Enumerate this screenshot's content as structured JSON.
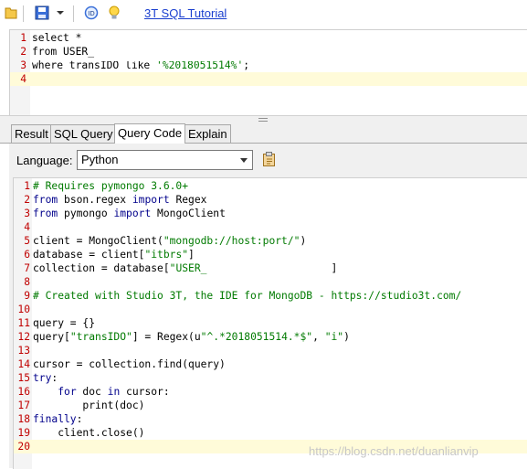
{
  "toolbar": {
    "link_label": "3T SQL Tutorial",
    "icons": [
      "open-folder-icon",
      "save-icon",
      "dropdown-arrow-icon",
      "connect-icon",
      "lightbulb-icon"
    ]
  },
  "sql_editor": {
    "lines": [
      {
        "n": "1",
        "parts": [
          {
            "t": "select *",
            "c": "plain"
          }
        ]
      },
      {
        "n": "2",
        "parts": [
          {
            "t": "from USER_",
            "c": "plain"
          }
        ]
      },
      {
        "n": "3",
        "parts": [
          {
            "t": "where transIDO like ",
            "c": "plain"
          },
          {
            "t": "'%2018051514%'",
            "c": "str"
          },
          {
            "t": ";",
            "c": "plain"
          }
        ]
      },
      {
        "n": "4",
        "parts": []
      }
    ]
  },
  "tabs": [
    {
      "label": "Result",
      "active": false
    },
    {
      "label": "SQL Query",
      "active": false
    },
    {
      "label": "Query Code",
      "active": true
    },
    {
      "label": "Explain",
      "active": false
    }
  ],
  "language": {
    "label": "Language:",
    "selected": "Python"
  },
  "python_code": {
    "lines": [
      {
        "n": "1",
        "parts": [
          {
            "t": "# Requires pymongo 3.6.0+",
            "c": "cmt"
          }
        ]
      },
      {
        "n": "2",
        "parts": [
          {
            "t": "from",
            "c": "kw"
          },
          {
            "t": " bson.regex ",
            "c": "plain"
          },
          {
            "t": "import",
            "c": "kw"
          },
          {
            "t": " Regex",
            "c": "plain"
          }
        ]
      },
      {
        "n": "3",
        "parts": [
          {
            "t": "from",
            "c": "kw"
          },
          {
            "t": " pymongo ",
            "c": "plain"
          },
          {
            "t": "import",
            "c": "kw"
          },
          {
            "t": " MongoClient",
            "c": "plain"
          }
        ]
      },
      {
        "n": "4",
        "parts": []
      },
      {
        "n": "5",
        "parts": [
          {
            "t": "client = MongoClient(",
            "c": "plain"
          },
          {
            "t": "\"mongodb://host:port/\"",
            "c": "str"
          },
          {
            "t": ")",
            "c": "plain"
          }
        ]
      },
      {
        "n": "6",
        "parts": [
          {
            "t": "database = client[",
            "c": "plain"
          },
          {
            "t": "\"itbrs\"",
            "c": "str"
          },
          {
            "t": "]",
            "c": "plain"
          }
        ]
      },
      {
        "n": "7",
        "parts": [
          {
            "t": "collection = database[",
            "c": "plain"
          },
          {
            "t": "\"USER_",
            "c": "str"
          },
          {
            "t": "                    ",
            "c": "plain"
          },
          {
            "t": "]",
            "c": "plain"
          }
        ]
      },
      {
        "n": "8",
        "parts": []
      },
      {
        "n": "9",
        "parts": [
          {
            "t": "# Created with Studio 3T, the IDE for MongoDB - https://studio3t.com/",
            "c": "cmt"
          }
        ]
      },
      {
        "n": "10",
        "parts": []
      },
      {
        "n": "11",
        "parts": [
          {
            "t": "query = {}",
            "c": "plain"
          }
        ]
      },
      {
        "n": "12",
        "parts": [
          {
            "t": "query[",
            "c": "plain"
          },
          {
            "t": "\"transIDO\"",
            "c": "str"
          },
          {
            "t": "] = Regex(u",
            "c": "plain"
          },
          {
            "t": "\"^.*2018051514.*$\"",
            "c": "str"
          },
          {
            "t": ", ",
            "c": "plain"
          },
          {
            "t": "\"i\"",
            "c": "str"
          },
          {
            "t": ")",
            "c": "plain"
          }
        ]
      },
      {
        "n": "13",
        "parts": []
      },
      {
        "n": "14",
        "parts": [
          {
            "t": "cursor = collection.find(query)",
            "c": "plain"
          }
        ]
      },
      {
        "n": "15",
        "parts": [
          {
            "t": "try",
            "c": "kw"
          },
          {
            "t": ":",
            "c": "plain"
          }
        ]
      },
      {
        "n": "16",
        "parts": [
          {
            "t": "    ",
            "c": "plain"
          },
          {
            "t": "for",
            "c": "kw"
          },
          {
            "t": " doc ",
            "c": "plain"
          },
          {
            "t": "in",
            "c": "kw"
          },
          {
            "t": " cursor:",
            "c": "plain"
          }
        ]
      },
      {
        "n": "17",
        "parts": [
          {
            "t": "        print(doc)",
            "c": "plain"
          }
        ]
      },
      {
        "n": "18",
        "parts": [
          {
            "t": "finally",
            "c": "kw"
          },
          {
            "t": ":",
            "c": "plain"
          }
        ]
      },
      {
        "n": "19",
        "parts": [
          {
            "t": "    client.close()",
            "c": "plain"
          }
        ]
      },
      {
        "n": "20",
        "parts": []
      }
    ]
  },
  "watermark": "https://blog.csdn.net/duanlianvip",
  "colors": {
    "keyword": "#00008b",
    "string": "#007a00",
    "comment": "#007a00",
    "line_number": "#c00000",
    "current_line": "#fffbd9",
    "link": "#1a3fcf"
  }
}
